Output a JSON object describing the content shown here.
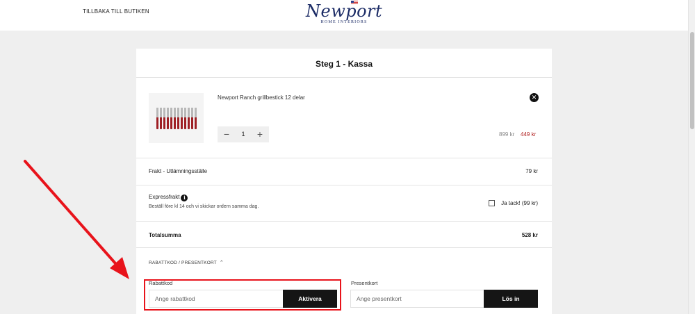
{
  "header": {
    "back_link": "TILLBAKA TILL BUTIKEN",
    "logo": "Newport",
    "logo_sub": "HOME INTERIORS"
  },
  "checkout": {
    "title": "Steg 1 - Kassa",
    "product": {
      "name": "Newport Ranch grillbestick 12 delar",
      "quantity": "1",
      "old_price": "899 kr",
      "price": "449 kr",
      "remove_icon": "close-icon"
    },
    "shipping": {
      "label": "Frakt - Utlämningsställe",
      "value": "79 kr"
    },
    "express": {
      "label": "Expressfrakt",
      "note": "Beställ före kl 14 och vi skickar ordern samma dag.",
      "option": "Ja tack! (99 kr)",
      "checked": false
    },
    "total": {
      "label": "Totalsumma",
      "value": "528 kr"
    },
    "discount_toggle": "RABATTKOD / PRESENTKORT",
    "discount": {
      "label": "Rabattkod",
      "placeholder": "Ange rabattkod",
      "button": "Aktivera"
    },
    "giftcard": {
      "label": "Presentkort",
      "placeholder": "Ange presentkort",
      "button": "Lös in"
    }
  },
  "colors": {
    "annotation": "#e8131b",
    "sale_price": "#b01e1e",
    "logo": "#1c2c66"
  }
}
